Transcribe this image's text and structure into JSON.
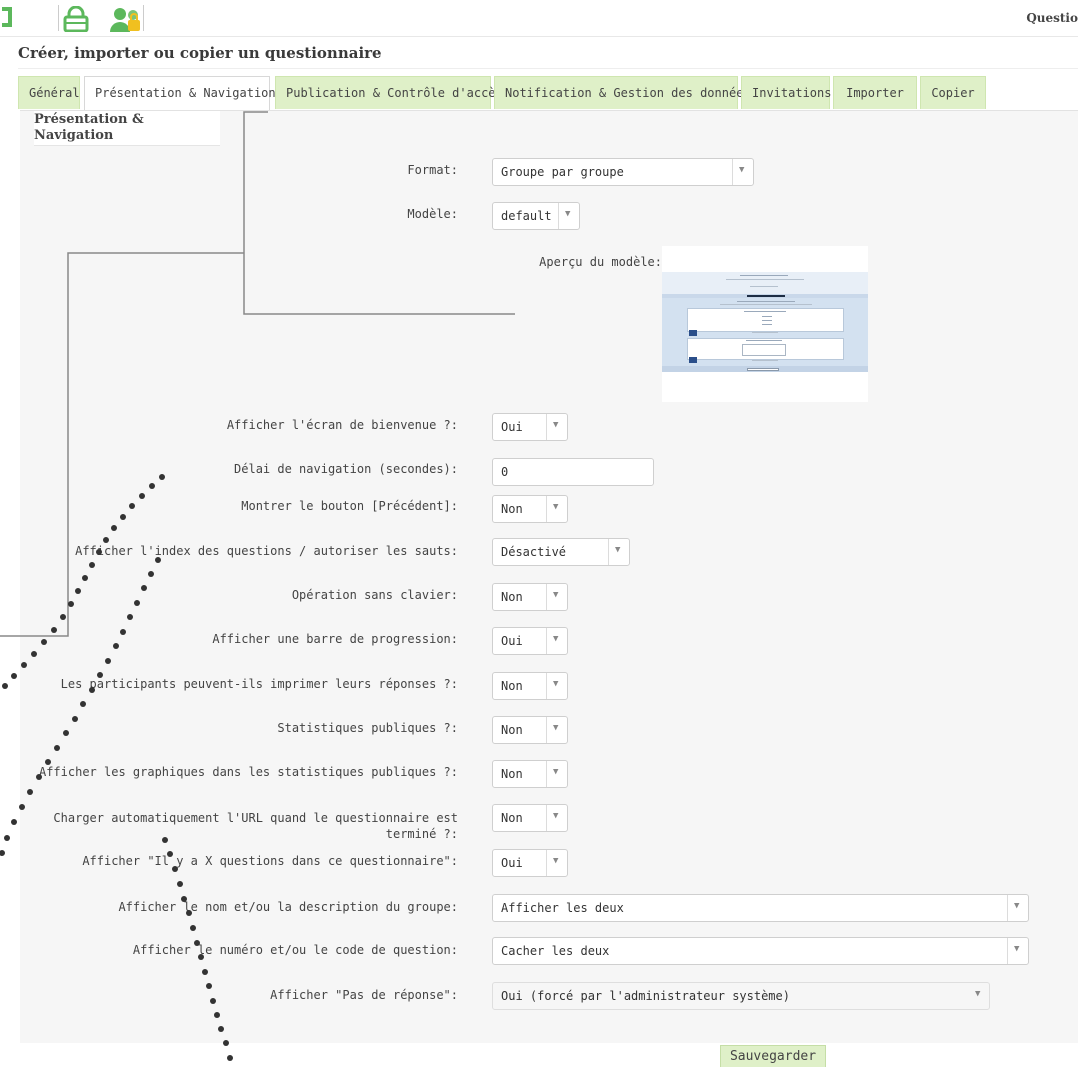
{
  "header": {
    "right_title": "Questio",
    "icons": [
      "home-icon",
      "lock-icon",
      "user-permissions-icon"
    ]
  },
  "page": {
    "title": "Créer, importer ou copier un questionnaire"
  },
  "tabs": [
    {
      "label": "Général",
      "active": false
    },
    {
      "label": "Présentation & Navigation",
      "active": true
    },
    {
      "label": "Publication & Contrôle d'accès",
      "active": false
    },
    {
      "label": "Notification & Gestion des données",
      "active": false
    },
    {
      "label": "Invitations",
      "active": false
    },
    {
      "label": "Importer",
      "active": false
    },
    {
      "label": "Copier",
      "active": false
    }
  ],
  "panel": {
    "heading": "Présentation & Navigation",
    "fields": {
      "format": {
        "label": "Format:",
        "value": "Groupe par groupe"
      },
      "template": {
        "label": "Modèle:",
        "value": "default"
      },
      "template_preview": {
        "label": "Aperçu du modèle:"
      },
      "welcome_screen": {
        "label": "Afficher l'écran de bienvenue ?:",
        "value": "Oui"
      },
      "navigation_delay": {
        "label": "Délai de navigation (secondes):",
        "value": "0"
      },
      "previous_button": {
        "label": "Montrer le bouton [Précédent]:",
        "value": "Non"
      },
      "question_index": {
        "label": "Afficher l'index des questions / autoriser les sauts:",
        "value": "Désactivé"
      },
      "keyboardless": {
        "label": "Opération sans clavier:",
        "value": "Non"
      },
      "progress_bar": {
        "label": "Afficher une barre de progression:",
        "value": "Oui"
      },
      "print_answers": {
        "label": "Les participants peuvent-ils imprimer leurs réponses ?:",
        "value": "Non"
      },
      "public_stats": {
        "label": "Statistiques publiques ?:",
        "value": "Non"
      },
      "public_graphs": {
        "label": "Afficher les graphiques dans les statistiques publiques ?:",
        "value": "Non"
      },
      "autoload_url": {
        "label": "Charger automatiquement l'URL quand le questionnaire est terminé ?:",
        "value": "Non"
      },
      "x_questions": {
        "label": "Afficher \"Il y a X questions dans ce questionnaire\":",
        "value": "Oui"
      },
      "group_info": {
        "label": "Afficher le nom et/ou la description du groupe:",
        "value": "Afficher les deux"
      },
      "question_number": {
        "label": "Afficher le numéro et/ou le code de question:",
        "value": "Cacher les deux"
      },
      "no_answer": {
        "label": "Afficher \"Pas de réponse\":",
        "value": "Oui (forcé par l'administrateur système)"
      }
    },
    "save_label": "Sauvegarder"
  },
  "colors": {
    "tab_background": "#dff0c8",
    "accent_green": "#5cb85c",
    "panel_background": "#f6f6f6"
  }
}
